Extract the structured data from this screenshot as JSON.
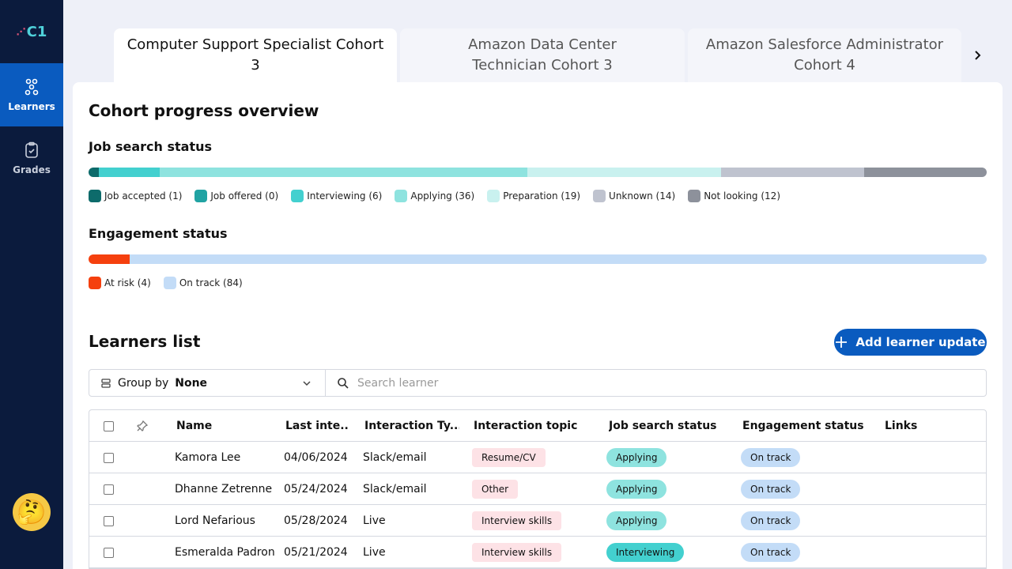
{
  "app": {
    "logo_text": "C1",
    "logo_dots": "⋰"
  },
  "sidebar": {
    "items": [
      {
        "label": "Learners",
        "icon": "learners-icon",
        "active": true
      },
      {
        "label": "Grades",
        "icon": "clipboard-check-icon",
        "active": false
      }
    ],
    "avatar_emoji": "🤔"
  },
  "tabs": [
    {
      "label": "Computer Support Specialist Cohort 3",
      "active": true
    },
    {
      "label": "Amazon Data Center Technician Cohort 3",
      "active": false
    },
    {
      "label": "Amazon Salesforce Administrator Cohort 4",
      "active": false
    }
  ],
  "overview": {
    "title": "Cohort progress overview",
    "job_search": {
      "title": "Job search status",
      "segments": [
        {
          "label": "Job accepted (1)",
          "count": 1,
          "color": "#0d6b6b"
        },
        {
          "label": "Job offered (0)",
          "count": 0,
          "color": "#21a3a3"
        },
        {
          "label": "Interviewing (6)",
          "count": 6,
          "color": "#43d0cf"
        },
        {
          "label": "Applying (36)",
          "count": 36,
          "color": "#8ee3df"
        },
        {
          "label": "Preparation (19)",
          "count": 19,
          "color": "#c9f1ef"
        },
        {
          "label": "Unknown (14)",
          "count": 14,
          "color": "#bfc3cf"
        },
        {
          "label": "Not looking (12)",
          "count": 12,
          "color": "#8d919b"
        }
      ]
    },
    "engagement": {
      "title": "Engagement status",
      "segments": [
        {
          "label": "At risk (4)",
          "count": 4,
          "color": "#f5400e"
        },
        {
          "label": "On track (84)",
          "count": 84,
          "color": "#c3dcf7"
        }
      ]
    }
  },
  "learners": {
    "title": "Learners list",
    "add_button": "Add learner update",
    "group_by_label": "Group by",
    "group_by_value": "None",
    "search_placeholder": "Search learner",
    "columns": [
      "Name",
      "Last inte...",
      "Interaction Ty...",
      "Interaction topic",
      "Job search status",
      "Engagement status",
      "Links"
    ],
    "rows": [
      {
        "name": "Kamora Lee",
        "date": "04/06/2024",
        "type": "Slack/email",
        "topic": "Resume/CV",
        "job": "Applying",
        "engagement": "On track"
      },
      {
        "name": "Dhanne Zetrenne",
        "date": "05/24/2024",
        "type": "Slack/email",
        "topic": "Other",
        "job": "Applying",
        "engagement": "On track"
      },
      {
        "name": "Lord Nefarious",
        "date": "05/28/2024",
        "type": "Live",
        "topic": "Interview skills",
        "job": "Applying",
        "engagement": "On track"
      },
      {
        "name": "Esmeralda Padron",
        "date": "05/21/2024",
        "type": "Live",
        "topic": "Interview skills",
        "job": "Interviewing",
        "engagement": "On track"
      }
    ],
    "status_colors": {
      "Applying": "#8ee3df",
      "Interviewing": "#43d0cf",
      "On track": "#c3dcf7"
    }
  }
}
